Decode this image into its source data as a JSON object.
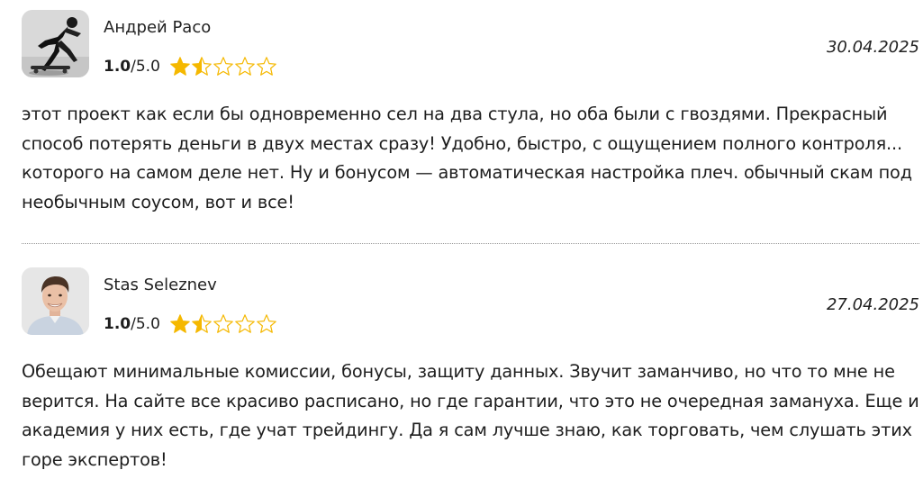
{
  "reviews": [
    {
      "author": "Андрей Расо",
      "avatar_icon": "skateboarder-photo-icon",
      "rating_score": "1.0",
      "rating_max": "/5.0",
      "rating_value": 1.5,
      "date": "30.04.2025",
      "text": "этот проект как если бы одновременно сел на два стула, но оба были с гвоздями. Прекрасный способ потерять деньги в двух местах сразу! Удобно, быстро, с ощущением полного контроля... которого на самом деле нет. Ну и бонусом — автоматическая настройка плеч. обычный скам под необычным соусом, вот и все!"
    },
    {
      "author": "Stas Seleznev",
      "avatar_icon": "man-portrait-photo-icon",
      "rating_score": "1.0",
      "rating_max": "/5.0",
      "rating_value": 1.5,
      "date": "27.04.2025",
      "text": "Обещают минимальные комиссии, бонусы, защиту данных. Звучит заманчиво, но что то мне не верится. На сайте все красиво расписано, но где гарантии, что это не очередная замануха. Еще и академия у них есть, где учат трейдингу. Да я сам лучше знаю, как торговать, чем слушать этих горе экспертов!"
    }
  ],
  "colors": {
    "star": "#f5b800",
    "text": "#1e1e1e",
    "divider": "#9a9a9a"
  }
}
